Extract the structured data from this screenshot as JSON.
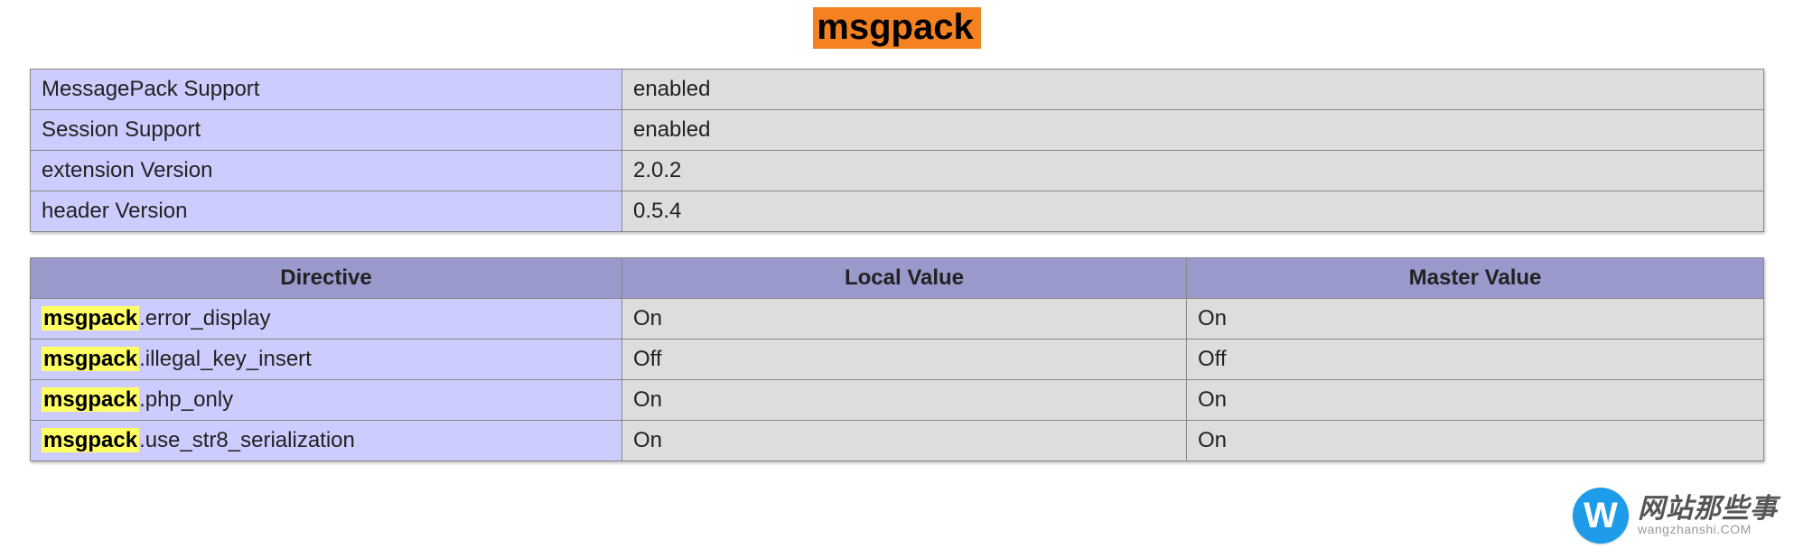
{
  "heading": "msgpack",
  "info_rows": [
    {
      "key": "MessagePack Support",
      "value": "enabled"
    },
    {
      "key": "Session Support",
      "value": "enabled"
    },
    {
      "key": "extension Version",
      "value": "2.0.2"
    },
    {
      "key": "header Version",
      "value": "0.5.4"
    }
  ],
  "directive_headers": {
    "directive": "Directive",
    "local": "Local Value",
    "master": "Master Value"
  },
  "highlight_prefix": "msgpack",
  "directives": [
    {
      "suffix": ".error_display",
      "local": "On",
      "master": "On"
    },
    {
      "suffix": ".illegal_key_insert",
      "local": "Off",
      "master": "Off"
    },
    {
      "suffix": ".php_only",
      "local": "On",
      "master": "On"
    },
    {
      "suffix": ".use_str8_serialization",
      "local": "On",
      "master": "On"
    }
  ],
  "logo": {
    "letter": "W",
    "cn": "网站那些事",
    "en": "wangzhanshi.COM"
  }
}
